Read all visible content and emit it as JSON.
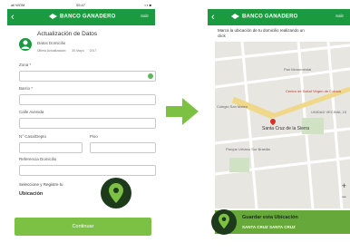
{
  "left_screen": {
    "status": {
      "carrier": "all WOM",
      "time": "09:47",
      "battery": "▪ ▪ ■"
    },
    "topbar": {
      "back": "‹",
      "brand": "BANCO GANADERO",
      "exit": "Salir"
    },
    "header": {
      "title": "Actualización de Datos",
      "subtitle": "Datos Domicilio",
      "last_update_label": "Última Actualización:",
      "last_update_day": "30 Mayo",
      "last_update_year": "2017"
    },
    "fields": {
      "zone_label": "Zona *",
      "barrio_label": "Barrio *",
      "calle_label": "Calle Avenida",
      "casa_label": "N° Casa/Depto",
      "piso_label": "Piso",
      "referencia_label": "Referencia Domicilio"
    },
    "location_hint": "Seleccione y Registre tu",
    "location_label": "Ubicación",
    "continue_label": "Continuar"
  },
  "right_screen": {
    "topbar": {
      "back": "‹",
      "brand": "BANCO GANADERO",
      "exit": "Salir"
    },
    "instruction": "Marca la ubicación de tu domicilio realizando un click",
    "map": {
      "labels": [
        "Pan Monumental",
        "Centro de Salud Virgen de Cotoca",
        "Colegio San Mateo",
        "Santa Cruz de la Sierra",
        "UNIDAD VECINAL 15",
        "Parque Urbano Sur Brasilla"
      ],
      "zoom_in": "+",
      "zoom_out": "−"
    },
    "save": {
      "title": "Guardar esta Ubicación",
      "address": "SANTA CRUZ SANTA CRUZ"
    }
  },
  "colors": {
    "brand_green": "#1b9a40",
    "button_green": "#7dc144",
    "pin_dark": "#1d3a1b",
    "save_green": "#66a83a"
  }
}
